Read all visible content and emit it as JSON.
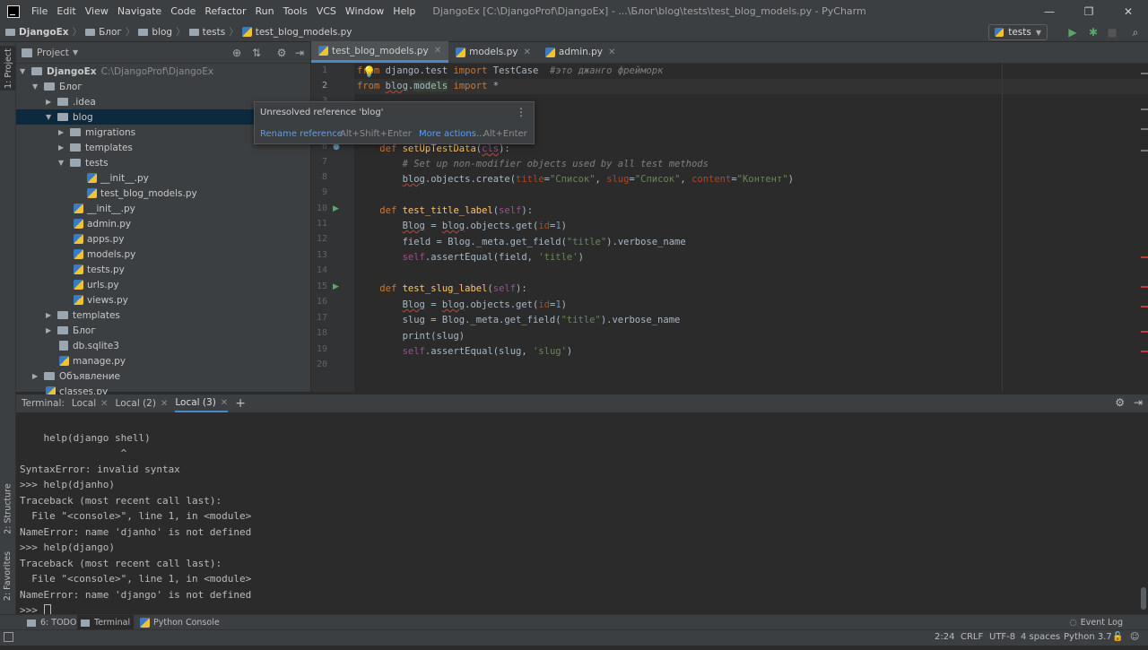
{
  "menubar": {
    "items": [
      "File",
      "Edit",
      "View",
      "Navigate",
      "Code",
      "Refactor",
      "Run",
      "Tools",
      "VCS",
      "Window",
      "Help"
    ],
    "title": "DjangoEx [C:\\DjangoProf\\DjangoEx] - ...\\Блог\\blog\\tests\\test_blog_models.py - PyCharm"
  },
  "navbar": {
    "crumbs": [
      "DjangoEx",
      "Блог",
      "blog",
      "tests",
      "test_blog_models.py"
    ],
    "run_config": "tests"
  },
  "sidebar": {
    "project_tab": "1: Project",
    "structure_tab": "2: Structure",
    "favorites_tab": "2: Favorites"
  },
  "project": {
    "title": "Project",
    "tree": [
      {
        "label": "DjangoEx",
        "sub": "C:\\DjangoProf\\DjangoEx"
      },
      {
        "label": "Блог"
      },
      {
        "label": ".idea"
      },
      {
        "label": "blog"
      },
      {
        "label": "migrations"
      },
      {
        "label": "templates"
      },
      {
        "label": "tests"
      },
      {
        "label": "__init__.py"
      },
      {
        "label": "test_blog_models.py"
      },
      {
        "label": "__init__.py"
      },
      {
        "label": "admin.py"
      },
      {
        "label": "apps.py"
      },
      {
        "label": "models.py"
      },
      {
        "label": "tests.py"
      },
      {
        "label": "urls.py"
      },
      {
        "label": "views.py"
      },
      {
        "label": "templates"
      },
      {
        "label": "Блог"
      },
      {
        "label": "db.sqlite3"
      },
      {
        "label": "manage.py"
      },
      {
        "label": "Объявление"
      },
      {
        "label": "classes.py"
      }
    ]
  },
  "editor": {
    "tabs": [
      "test_blog_models.py",
      "models.py",
      "admin.py"
    ],
    "line_numbers": [
      "1",
      "2",
      "3",
      "4",
      "5",
      "6",
      "7",
      "8",
      "9",
      "10",
      "11",
      "12",
      "13",
      "14",
      "15",
      "16",
      "17",
      "18",
      "19",
      "20"
    ]
  },
  "popup": {
    "message": "Unresolved reference 'blog'",
    "action1": "Rename reference",
    "key1": "Alt+Shift+Enter",
    "action2": "More actions...",
    "key2": "Alt+Enter"
  },
  "terminal": {
    "label": "Terminal:",
    "tabs": [
      "Local",
      "Local (2)",
      "Local (3)"
    ],
    "lines": [
      "    help(django shell)",
      "                 ^",
      "SyntaxError: invalid syntax",
      ">>> help(djanho)",
      "Traceback (most recent call last):",
      "  File \"<console>\", line 1, in <module>",
      "NameError: name 'djanho' is not defined",
      ">>> help(django)",
      "Traceback (most recent call last):",
      "  File \"<console>\", line 1, in <module>",
      "NameError: name 'django' is not defined",
      ">>> "
    ]
  },
  "bottombar": {
    "todo": "6: TODO",
    "terminal": "Terminal",
    "python_console": "Python Console",
    "event_log": "Event Log"
  },
  "status": {
    "position": "2:24",
    "line_sep": "CRLF",
    "encoding": "UTF-8",
    "indent": "4 spaces",
    "interpreter": "Python 3.7"
  }
}
